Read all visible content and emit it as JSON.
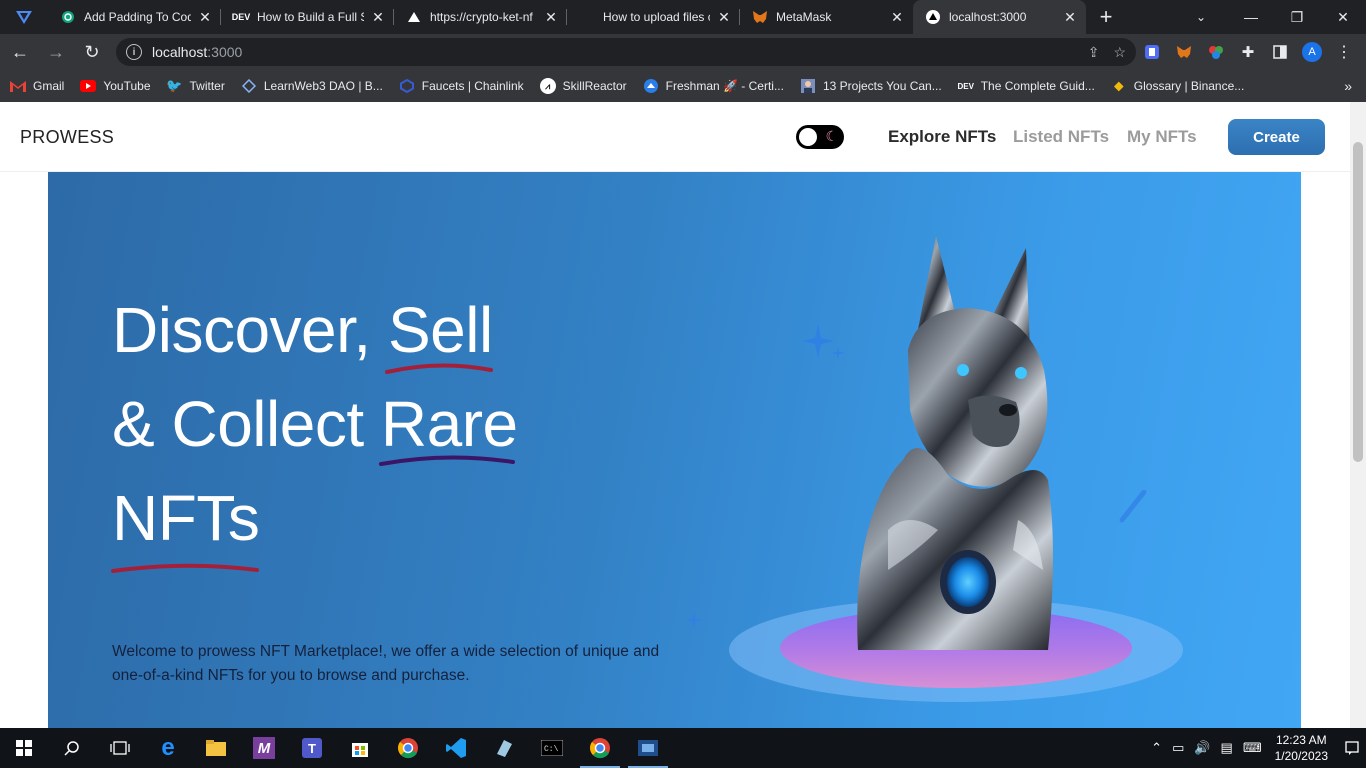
{
  "browser": {
    "tabs": [
      {
        "title": "Add Padding To Cod",
        "icon": "chatgpt-icon",
        "active": false
      },
      {
        "title": "How to Build a Full St",
        "icon": "dev-icon",
        "active": false
      },
      {
        "title": "https://crypto-ket-nf",
        "icon": "vercel-icon",
        "active": false
      },
      {
        "title": "How to upload files c",
        "icon": "blank-icon",
        "active": false
      },
      {
        "title": "MetaMask",
        "icon": "metamask-icon",
        "active": false
      },
      {
        "title": "localhost:3000",
        "icon": "vercel-icon",
        "active": true
      }
    ],
    "url_host": "localhost",
    "url_port": ":3000",
    "bookmarks": [
      {
        "label": "Gmail"
      },
      {
        "label": "YouTube"
      },
      {
        "label": "Twitter"
      },
      {
        "label": "LearnWeb3 DAO | B..."
      },
      {
        "label": "Faucets | Chainlink"
      },
      {
        "label": "SkillReactor"
      },
      {
        "label": "Freshman 🚀 - Certi..."
      },
      {
        "label": "13 Projects You Can..."
      },
      {
        "label": "The Complete Guid..."
      },
      {
        "label": "Glossary | Binance..."
      }
    ]
  },
  "site": {
    "brand": "PROWESS",
    "nav": {
      "explore": "Explore NFTs",
      "listed": "Listed NFTs",
      "mine": "My NFTs",
      "create": "Create"
    },
    "hero": {
      "line1_a": "Discover, ",
      "line1_b": "Sell",
      "line2_a": "& Collect ",
      "line2_b": "Rare",
      "line3": "NFTs",
      "description": "Welcome to prowess NFT Marketplace!, we offer a wide selection of unique and one-of-a-kind NFTs for you to browse and purchase."
    },
    "colors": {
      "hero_start": "#2d6aa7",
      "hero_end": "#41a7f5",
      "create_button": "#3a84c6",
      "underline_red": "#a3203a",
      "underline_purple": "#3b1566"
    }
  },
  "taskbar": {
    "time": "12:23 AM",
    "date": "1/20/2023"
  }
}
